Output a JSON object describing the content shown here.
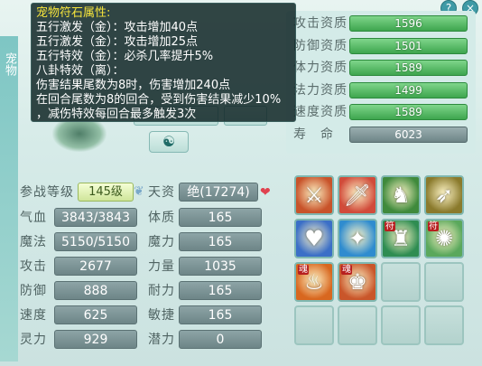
{
  "window": {
    "side_tab": "宠物",
    "help_icon": "?",
    "close_icon": "×"
  },
  "tooltip": {
    "title": "宠物符石属性:",
    "lines": [
      "五行激发（金）：攻击增加40点",
      "五行激发（金）：攻击增加25点",
      "五行特效（金）：必杀几率提升5%",
      "八卦特效（离）：",
      "伤害结果尾数为8时，伤害增加240点",
      "在回合尾数为8的回合，受到伤害结果减少10%",
      "，减伤特效每回合最多触发3次"
    ]
  },
  "resources": [
    {
      "label": "攻击资质",
      "value": "1596",
      "style": "green"
    },
    {
      "label": "防御资质",
      "value": "1501",
      "style": "green"
    },
    {
      "label": "体力资质",
      "value": "1589",
      "style": "green"
    },
    {
      "label": "法力资质",
      "value": "1499",
      "style": "green"
    },
    {
      "label": "速度资质",
      "value": "1589",
      "style": "green"
    },
    {
      "label": "寿　命",
      "value": "6023",
      "style": "gray"
    }
  ],
  "attributes": {
    "level_label": "参战等级",
    "level_value": "145级",
    "talent_label": "天资",
    "talent_value": "绝(17274)",
    "rows": [
      {
        "l1": "气血",
        "v1": "3843/3843",
        "l2": "体质",
        "v2": "165"
      },
      {
        "l1": "魔法",
        "v1": "5150/5150",
        "l2": "魔力",
        "v2": "165"
      },
      {
        "l1": "攻击",
        "v1": "2677",
        "l2": "力量",
        "v2": "1035"
      },
      {
        "l1": "防御",
        "v1": "888",
        "l2": "耐力",
        "v2": "165"
      },
      {
        "l1": "速度",
        "v1": "625",
        "l2": "敏捷",
        "v2": "165"
      },
      {
        "l1": "灵力",
        "v1": "929",
        "l2": "潜力",
        "v2": "0"
      }
    ]
  },
  "skills": [
    {
      "icon": "sword-strike-icon",
      "glyph": "⚔",
      "color": "#c8532a",
      "tag": ""
    },
    {
      "icon": "blade-icon",
      "glyph": "🗡",
      "color": "#d14b3a",
      "tag": ""
    },
    {
      "icon": "warrior-icon",
      "glyph": "♞",
      "color": "#3f8a3c",
      "tag": ""
    },
    {
      "icon": "boot-icon",
      "glyph": "➶",
      "color": "#8a7a2c",
      "tag": ""
    },
    {
      "icon": "heart-shield-icon",
      "glyph": "♥",
      "color": "#3b6fc7",
      "tag": ""
    },
    {
      "icon": "light-pillar-icon",
      "glyph": "✦",
      "color": "#2f8ccf",
      "tag": ""
    },
    {
      "icon": "talisman-figure-icon",
      "glyph": "♜",
      "color": "#2f8d52",
      "tag": "符"
    },
    {
      "icon": "talisman-burst-icon",
      "glyph": "✺",
      "color": "#5aa85c",
      "tag": "符"
    },
    {
      "icon": "fire-soul-icon",
      "glyph": "♨",
      "color": "#d8671f",
      "tag": "魂"
    },
    {
      "icon": "strongman-icon",
      "glyph": "♚",
      "color": "#c9562a",
      "tag": "魂"
    }
  ]
}
